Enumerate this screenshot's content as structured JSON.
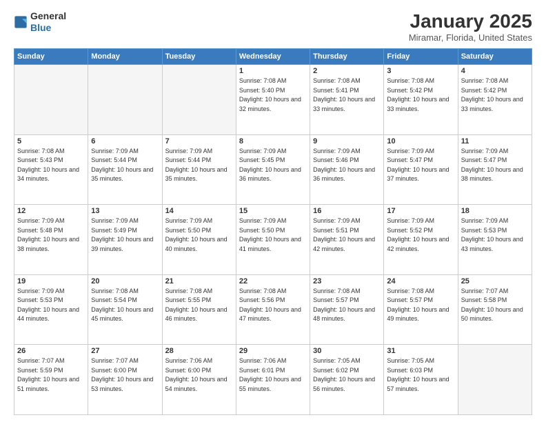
{
  "header": {
    "logo_general": "General",
    "logo_blue": "Blue",
    "month": "January 2025",
    "location": "Miramar, Florida, United States"
  },
  "days_of_week": [
    "Sunday",
    "Monday",
    "Tuesday",
    "Wednesday",
    "Thursday",
    "Friday",
    "Saturday"
  ],
  "weeks": [
    [
      {
        "day": "",
        "empty": true
      },
      {
        "day": "",
        "empty": true
      },
      {
        "day": "",
        "empty": true
      },
      {
        "day": "1",
        "sunrise": "7:08 AM",
        "sunset": "5:40 PM",
        "daylight": "10 hours and 32 minutes."
      },
      {
        "day": "2",
        "sunrise": "7:08 AM",
        "sunset": "5:41 PM",
        "daylight": "10 hours and 33 minutes."
      },
      {
        "day": "3",
        "sunrise": "7:08 AM",
        "sunset": "5:42 PM",
        "daylight": "10 hours and 33 minutes."
      },
      {
        "day": "4",
        "sunrise": "7:08 AM",
        "sunset": "5:42 PM",
        "daylight": "10 hours and 33 minutes."
      }
    ],
    [
      {
        "day": "5",
        "sunrise": "7:08 AM",
        "sunset": "5:43 PM",
        "daylight": "10 hours and 34 minutes."
      },
      {
        "day": "6",
        "sunrise": "7:09 AM",
        "sunset": "5:44 PM",
        "daylight": "10 hours and 35 minutes."
      },
      {
        "day": "7",
        "sunrise": "7:09 AM",
        "sunset": "5:44 PM",
        "daylight": "10 hours and 35 minutes."
      },
      {
        "day": "8",
        "sunrise": "7:09 AM",
        "sunset": "5:45 PM",
        "daylight": "10 hours and 36 minutes."
      },
      {
        "day": "9",
        "sunrise": "7:09 AM",
        "sunset": "5:46 PM",
        "daylight": "10 hours and 36 minutes."
      },
      {
        "day": "10",
        "sunrise": "7:09 AM",
        "sunset": "5:47 PM",
        "daylight": "10 hours and 37 minutes."
      },
      {
        "day": "11",
        "sunrise": "7:09 AM",
        "sunset": "5:47 PM",
        "daylight": "10 hours and 38 minutes."
      }
    ],
    [
      {
        "day": "12",
        "sunrise": "7:09 AM",
        "sunset": "5:48 PM",
        "daylight": "10 hours and 38 minutes."
      },
      {
        "day": "13",
        "sunrise": "7:09 AM",
        "sunset": "5:49 PM",
        "daylight": "10 hours and 39 minutes."
      },
      {
        "day": "14",
        "sunrise": "7:09 AM",
        "sunset": "5:50 PM",
        "daylight": "10 hours and 40 minutes."
      },
      {
        "day": "15",
        "sunrise": "7:09 AM",
        "sunset": "5:50 PM",
        "daylight": "10 hours and 41 minutes."
      },
      {
        "day": "16",
        "sunrise": "7:09 AM",
        "sunset": "5:51 PM",
        "daylight": "10 hours and 42 minutes."
      },
      {
        "day": "17",
        "sunrise": "7:09 AM",
        "sunset": "5:52 PM",
        "daylight": "10 hours and 42 minutes."
      },
      {
        "day": "18",
        "sunrise": "7:09 AM",
        "sunset": "5:53 PM",
        "daylight": "10 hours and 43 minutes."
      }
    ],
    [
      {
        "day": "19",
        "sunrise": "7:09 AM",
        "sunset": "5:53 PM",
        "daylight": "10 hours and 44 minutes."
      },
      {
        "day": "20",
        "sunrise": "7:08 AM",
        "sunset": "5:54 PM",
        "daylight": "10 hours and 45 minutes."
      },
      {
        "day": "21",
        "sunrise": "7:08 AM",
        "sunset": "5:55 PM",
        "daylight": "10 hours and 46 minutes."
      },
      {
        "day": "22",
        "sunrise": "7:08 AM",
        "sunset": "5:56 PM",
        "daylight": "10 hours and 47 minutes."
      },
      {
        "day": "23",
        "sunrise": "7:08 AM",
        "sunset": "5:57 PM",
        "daylight": "10 hours and 48 minutes."
      },
      {
        "day": "24",
        "sunrise": "7:08 AM",
        "sunset": "5:57 PM",
        "daylight": "10 hours and 49 minutes."
      },
      {
        "day": "25",
        "sunrise": "7:07 AM",
        "sunset": "5:58 PM",
        "daylight": "10 hours and 50 minutes."
      }
    ],
    [
      {
        "day": "26",
        "sunrise": "7:07 AM",
        "sunset": "5:59 PM",
        "daylight": "10 hours and 51 minutes."
      },
      {
        "day": "27",
        "sunrise": "7:07 AM",
        "sunset": "6:00 PM",
        "daylight": "10 hours and 53 minutes."
      },
      {
        "day": "28",
        "sunrise": "7:06 AM",
        "sunset": "6:00 PM",
        "daylight": "10 hours and 54 minutes."
      },
      {
        "day": "29",
        "sunrise": "7:06 AM",
        "sunset": "6:01 PM",
        "daylight": "10 hours and 55 minutes."
      },
      {
        "day": "30",
        "sunrise": "7:05 AM",
        "sunset": "6:02 PM",
        "daylight": "10 hours and 56 minutes."
      },
      {
        "day": "31",
        "sunrise": "7:05 AM",
        "sunset": "6:03 PM",
        "daylight": "10 hours and 57 minutes."
      },
      {
        "day": "",
        "empty": true
      }
    ]
  ]
}
